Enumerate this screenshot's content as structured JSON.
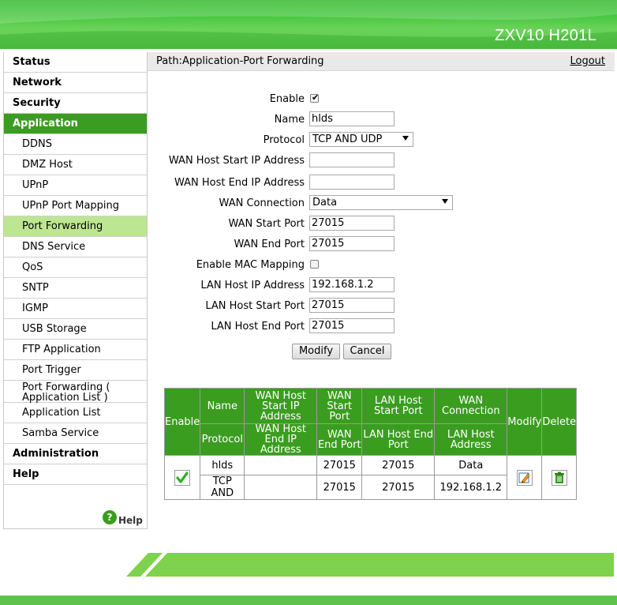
{
  "header": {
    "product": "ZXV10 H201L"
  },
  "sidebar": {
    "items": [
      {
        "label": "Status",
        "level": "top"
      },
      {
        "label": "Network",
        "level": "top"
      },
      {
        "label": "Security",
        "level": "top"
      },
      {
        "label": "Application",
        "level": "top",
        "active": true
      },
      {
        "label": "DDNS",
        "level": "sub"
      },
      {
        "label": "DMZ Host",
        "level": "sub"
      },
      {
        "label": "UPnP",
        "level": "sub"
      },
      {
        "label": "UPnP Port Mapping",
        "level": "sub"
      },
      {
        "label": "Port Forwarding",
        "level": "sub",
        "active": true
      },
      {
        "label": "DNS Service",
        "level": "sub"
      },
      {
        "label": "QoS",
        "level": "sub"
      },
      {
        "label": "SNTP",
        "level": "sub"
      },
      {
        "label": "IGMP",
        "level": "sub"
      },
      {
        "label": "USB Storage",
        "level": "sub"
      },
      {
        "label": "FTP Application",
        "level": "sub"
      },
      {
        "label": "Port Trigger",
        "level": "sub"
      },
      {
        "label": "Port Forwarding ( Application List )",
        "level": "sub",
        "line1": "Port Forwarding (",
        "line2": "Application List )"
      },
      {
        "label": "Application List",
        "level": "sub"
      },
      {
        "label": "Samba Service",
        "level": "sub"
      },
      {
        "label": "Administration",
        "level": "top"
      },
      {
        "label": "Help",
        "level": "top"
      }
    ],
    "help_label": "Help",
    "help_icon": "question-icon"
  },
  "pathbar": {
    "path": "Path:Application-Port Forwarding",
    "logout": "Logout"
  },
  "form": {
    "enable_label": "Enable",
    "enable_checked": true,
    "name_label": "Name",
    "name_value": "hlds",
    "protocol_label": "Protocol",
    "protocol_value": "TCP AND UDP",
    "wan_start_ip_label": "WAN Host Start IP Address",
    "wan_start_ip_value": "",
    "wan_end_ip_label": "WAN Host End IP Address",
    "wan_end_ip_value": "",
    "wan_conn_label": "WAN Connection",
    "wan_conn_value": "Data",
    "wan_start_port_label": "WAN Start Port",
    "wan_start_port_value": "27015",
    "wan_end_port_label": "WAN End Port",
    "wan_end_port_value": "27015",
    "mac_label": "Enable MAC Mapping",
    "mac_checked": false,
    "lan_ip_label": "LAN Host IP Address",
    "lan_ip_value": "192.168.1.2",
    "lan_start_port_label": "LAN Host Start Port",
    "lan_start_port_value": "27015",
    "lan_end_port_label": "LAN Host End Port",
    "lan_end_port_value": "27015",
    "modify_btn": "Modify",
    "cancel_btn": "Cancel"
  },
  "table": {
    "headers": {
      "enable": "Enable",
      "name": "Name",
      "wan_start_ip": "WAN Host Start IP Address",
      "wan_start_port": "WAN Start Port",
      "lan_start_port": "LAN Host Start Port",
      "wan_conn": "WAN Connection",
      "modify": "Modify",
      "delete": "Delete",
      "protocol": "Protocol",
      "wan_end_ip": "WAN Host End IP Address",
      "wan_end_port": "WAN End Port",
      "lan_end_port": "LAN Host End Port",
      "lan_ip": "LAN Host Address"
    },
    "row": {
      "name": "hlds",
      "wan_start_ip": "",
      "wan_start_port": "27015",
      "lan_start_port": "27015",
      "wan_conn": "Data",
      "protocol": "TCP AND",
      "wan_end_ip": "",
      "wan_end_port": "27015",
      "lan_end_port": "27015",
      "lan_ip": "192.168.1.2",
      "enable_icon": "green-check-icon",
      "modify_icon": "pencil-edit-icon",
      "delete_icon": "trash-icon"
    }
  },
  "colors": {
    "accent": "#3a9d1f",
    "active_sub": "#bde693",
    "header_green": "#3fc43a"
  }
}
